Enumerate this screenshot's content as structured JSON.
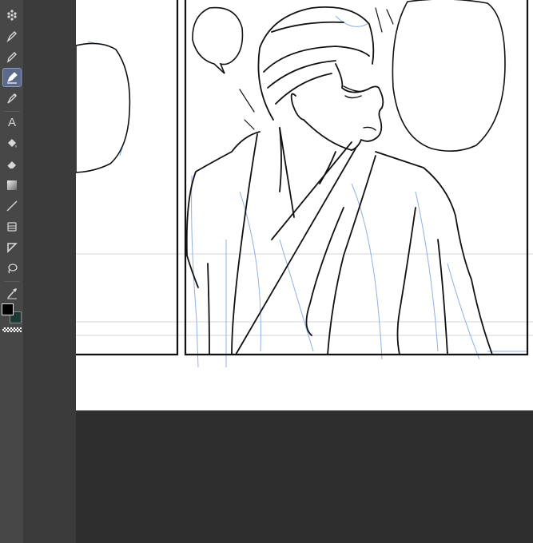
{
  "toolbar": {
    "tools": [
      {
        "name": "blend-tool",
        "icon": "dots-icon"
      },
      {
        "name": "pen-tool",
        "icon": "nib-icon"
      },
      {
        "name": "pencil-tool",
        "icon": "pencil-icon"
      },
      {
        "name": "ink-pen-tool",
        "icon": "nib-icon",
        "active": true
      },
      {
        "name": "marker-tool",
        "icon": "marker-icon"
      },
      {
        "name": "text-tool",
        "icon": "text-icon",
        "glyph": "A"
      },
      {
        "name": "fill-tool",
        "icon": "bucket-icon"
      },
      {
        "name": "eraser-tool",
        "icon": "eraser-icon"
      },
      {
        "name": "gradient-tool",
        "icon": "gradient-icon"
      },
      {
        "name": "line-tool",
        "icon": "line-icon"
      },
      {
        "name": "layer-tool",
        "icon": "stack-icon"
      },
      {
        "name": "frame-tool",
        "icon": "frame-icon"
      },
      {
        "name": "lasso-tool",
        "icon": "lasso-icon"
      },
      {
        "name": "eyedropper-tool",
        "icon": "eyedropper-icon"
      }
    ],
    "colors": {
      "foreground": "#000000",
      "background": "#1b3a34",
      "active_highlight": "#5c6a8a"
    }
  },
  "canvas": {
    "paper_color": "#ffffff",
    "ink_color": "#111111",
    "sketch_color": "#8fb0e0",
    "workspace_color": "#2e2e2e"
  }
}
